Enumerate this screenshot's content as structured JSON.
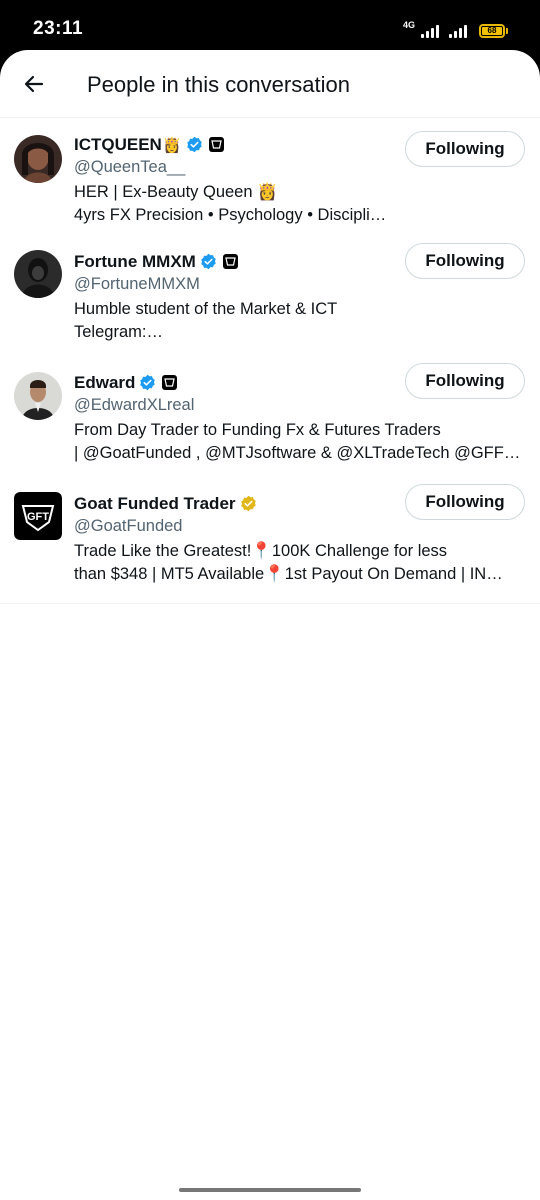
{
  "status_bar": {
    "time": "23:11",
    "network": "4G",
    "battery": "68",
    "battery_color": "#f2c200"
  },
  "header": {
    "title": "People in this conversation",
    "back_icon": "arrow-left-icon"
  },
  "people": [
    {
      "name": "ICTQUEEN",
      "name_emoji": "👸",
      "verified": "blue",
      "affiliate": true,
      "handle": "@QueenTea__",
      "bio_lines": [
        "HER | Ex-Beauty Queen 👸",
        "4yrs FX Precision • Psychology • Discipli…"
      ],
      "button": "Following"
    },
    {
      "name": "Fortune MMXM",
      "name_emoji": "",
      "verified": "blue",
      "affiliate": true,
      "handle": "@FortuneMMXM",
      "bio_lines": [
        "Humble student of the Market & ICT",
        "Telegram:…"
      ],
      "button": "Following"
    },
    {
      "name": "Edward",
      "name_emoji": "",
      "verified": "blue",
      "affiliate": true,
      "handle": "@EdwardXLreal",
      "bio_lines": [
        "From Day Trader to Funding Fx & Futures Traders",
        "| @GoatFunded , @MTJsoftware & @XLTradeTech @GFF…"
      ],
      "button": "Following"
    },
    {
      "name": "Goat Funded Trader",
      "name_emoji": "",
      "verified": "gold",
      "affiliate": false,
      "handle": "@GoatFunded",
      "bio_lines": [
        "Trade Like the Greatest!📍100K Challenge for less",
        "than $348 | MT5 Available📍1st Payout On Demand | IN…"
      ],
      "button": "Following"
    }
  ],
  "colors": {
    "verified_blue": "#1d9bf0",
    "verified_gold": "#e2b719",
    "secondary_text": "#536471",
    "border": "#cfd9de"
  }
}
